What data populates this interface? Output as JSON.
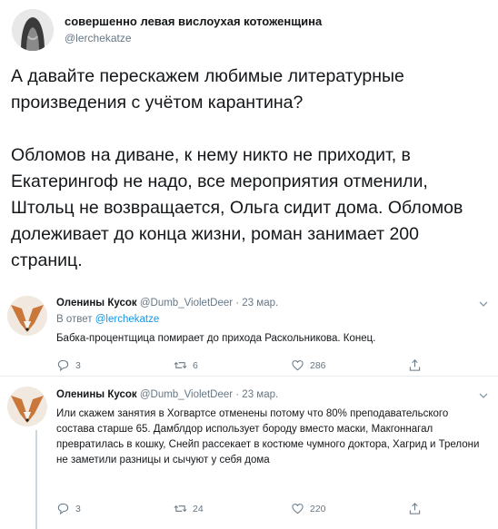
{
  "main": {
    "name": "совершенно левая вислоухая котоженщина",
    "handle": "@lerchekatze",
    "paragraph1": "А давайте перескажем любимые литературные произведения с учётом карантина?",
    "paragraph2": "Обломов на диване, к нему никто не приходит, в Екатерингоф не надо, все мероприятия отменили, Штольц не возвращается, Ольга сидит дома. Обломов долеживает до конца жизни, роман занимает 200 страниц."
  },
  "replies": [
    {
      "name": "Оленины Кусок",
      "handle": "@Dumb_VioletDeer",
      "time": "· 23 мар.",
      "reply_prefix": "В ответ",
      "reply_to": "@lerchekatze",
      "text": "Бабка-процентщица помирает до прихода Раскольникова. Конец.",
      "replies_count": "3",
      "retweets_count": "6",
      "likes_count": "286"
    },
    {
      "name": "Оленины Кусок",
      "handle": "@Dumb_VioletDeer",
      "time": "· 23 мар.",
      "text": "Или скажем занятия в Хогвартсе отменены потому что 80% преподавательского состава старше 65. Дамблдор использует бороду вместо маски, Макгоннагал превратилась в кошку, Снейп рассекает в костюме чумного доктора, Хагрид и Трелони не заметили разницы и сычуют у себя дома",
      "replies_count": "3",
      "retweets_count": "24",
      "likes_count": "220"
    }
  ],
  "colors": {
    "text": "#14171a",
    "muted": "#657786",
    "link": "#1b95e0",
    "divider": "#e6ecf0"
  }
}
